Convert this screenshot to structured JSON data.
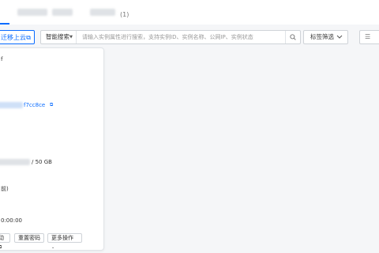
{
  "tabs": {
    "count": "(1)"
  },
  "toolbar": {
    "migrate_label": "迁移上云",
    "search_type": "智能搜索",
    "search_placeholder": "请输入实例属性进行搜索，支持实例ID、实例名称、公网IP、实例状态",
    "tag_filter_label": "标签筛选"
  },
  "panel": {
    "text_a": "f",
    "instance_id_suffix": "f7cc8ce",
    "disk_suffix": "/ 50 GB",
    "text_b": "前)",
    "time_suffix": "0:00:00",
    "buttons": {
      "btn1": "动",
      "btn2": "重置密码",
      "btn3": "更多操作"
    }
  },
  "colors": {
    "accent": "#0a6cff",
    "background": "#f5f6f8"
  },
  "icons": {
    "external": "external-link-icon",
    "search": "search-icon",
    "caret": "caret-down-icon",
    "chevron": "chevron-down-icon",
    "list": "list-view-icon",
    "copy": "copy-icon"
  }
}
